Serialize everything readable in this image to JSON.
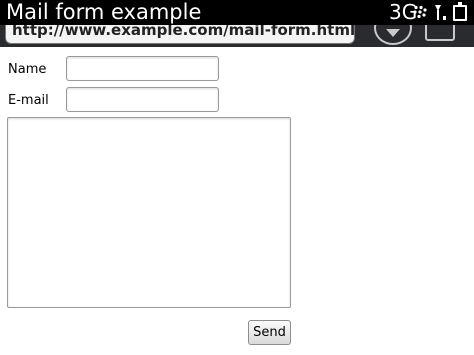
{
  "status_bar": {
    "title": "Mail form example",
    "network": "3G",
    "icons": [
      "blackberry-logo-icon",
      "signal-strength-icon",
      "battery-icon"
    ]
  },
  "browser": {
    "url": "http://www.example.com/mail-form.html",
    "icons": [
      "go-icon",
      "tabs-icon"
    ]
  },
  "form": {
    "name_label": "Name",
    "name_value": "",
    "email_label": "E-mail",
    "email_value": "",
    "message_value": "",
    "send_label": "Send"
  },
  "colors": {
    "status_bar_bg": "#000000",
    "browser_bar_bg": "#2a2b2e",
    "page_bg": "#ffffff"
  }
}
